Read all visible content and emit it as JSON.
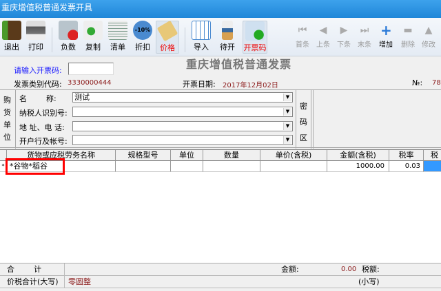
{
  "window": {
    "title": "重庆增值税普通发票开具"
  },
  "toolbar": {
    "items": [
      {
        "label": "退出",
        "icon": "exit-door-icon"
      },
      {
        "label": "打印",
        "icon": "printer-icon"
      },
      {
        "label": "负数",
        "icon": "negative-folder-icon"
      },
      {
        "label": "复制",
        "icon": "copy-icon"
      },
      {
        "label": "清单",
        "icon": "list-icon"
      },
      {
        "label": "折扣",
        "icon": "discount-icon",
        "badge": "-10%"
      },
      {
        "label": "价格",
        "icon": "price-tag-icon"
      },
      {
        "label": "导入",
        "icon": "import-icon"
      },
      {
        "label": "待开",
        "icon": "hourglass-icon"
      },
      {
        "label": "开票码",
        "icon": "invoice-code-icon"
      }
    ],
    "nav": [
      {
        "label": "首条"
      },
      {
        "label": "上条"
      },
      {
        "label": "下条"
      },
      {
        "label": "末条"
      },
      {
        "label": "增加"
      },
      {
        "label": "删除"
      },
      {
        "label": "修改"
      }
    ]
  },
  "invoice": {
    "title": "重庆增值税普通发票",
    "code_prompt": "请输入开票码:",
    "code_value": "",
    "type_code_label": "发票类别代码:",
    "type_code": "3330000444",
    "date_label": "开票日期:",
    "date": "2017年12月02日",
    "no_label": "№:",
    "no": "78"
  },
  "buyer": {
    "section_label": [
      "购",
      "货",
      "单",
      "位"
    ],
    "fields": [
      {
        "label": "名        称:",
        "value": "测试"
      },
      {
        "label": "纳税人识别号:",
        "value": ""
      },
      {
        "label": "地 址、电 话:",
        "value": ""
      },
      {
        "label": "开户行及帐号:",
        "value": ""
      }
    ],
    "cipher_label": [
      "密",
      "码",
      "区"
    ]
  },
  "grid": {
    "columns": [
      "货物或应税劳务名称",
      "规格型号",
      "单位",
      "数量",
      "单价(含税)",
      "金额(含税)",
      "税率",
      "税"
    ],
    "rows": [
      [
        "*谷物*稻谷",
        "",
        "",
        "",
        "",
        "1000.00",
        "0.03",
        ""
      ]
    ]
  },
  "totals": {
    "sum_label": "合        计",
    "amount_label": "金额:",
    "amount": "0.00",
    "tax_label": "税额:",
    "total_label": "价税合计(大写)",
    "total_upper": "零圆整",
    "lower_label": "(小写)"
  },
  "colors": {
    "titlebar": "#2e8fdc",
    "highlight": "#ff0000"
  }
}
